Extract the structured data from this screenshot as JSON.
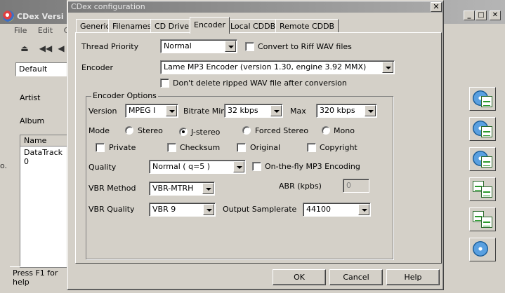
{
  "main_window": {
    "title": "CDex Versi",
    "menu": [
      "File",
      "Edit",
      "Con"
    ],
    "profile": "Default",
    "artist_label": "Artist",
    "album_label": "Album",
    "track_header": "Name",
    "track_row": "DataTrack 0",
    "status": "Press F1 for help",
    "left_edge_text": "o."
  },
  "dialog": {
    "title": "CDex configuration",
    "close_glyph": "✕",
    "tabs": [
      {
        "label": "Generic",
        "active": false
      },
      {
        "label": "Filenames",
        "active": false
      },
      {
        "label": "CD Drive",
        "active": false
      },
      {
        "label": "Encoder",
        "active": true
      },
      {
        "label": "Local CDDB",
        "active": false
      },
      {
        "label": "Remote CDDB",
        "active": false
      }
    ],
    "encoder_tab": {
      "thread_priority_label": "Thread Priority",
      "thread_priority_value": "Normal",
      "convert_riff_label": "Convert to Riff WAV files",
      "encoder_label": "Encoder",
      "encoder_value": "Lame MP3 Encoder (version 1.30, engine 3.92 MMX)",
      "dont_delete_label": "Don't delete ripped WAV file after conversion",
      "group_title": "Encoder Options",
      "version_label": "Version",
      "version_value": "MPEG I",
      "bitrate_min_label": "Bitrate Min",
      "bitrate_min_value": "32 kbps",
      "max_label": "Max",
      "max_value": "320 kbps",
      "mode_label": "Mode",
      "mode_options": [
        "Stereo",
        "J-stereo",
        "Forced Stereo",
        "Mono"
      ],
      "mode_selected": "J-stereo",
      "private_label": "Private",
      "checksum_label": "Checksum",
      "original_label": "Original",
      "copyright_label": "Copyright",
      "quality_label": "Quality",
      "quality_value": "Normal ( q=5 )",
      "onthefly_label": "On-the-fly MP3 Encoding",
      "vbr_method_label": "VBR Method",
      "vbr_method_value": "VBR-MTRH",
      "abr_label": "ABR (kpbs)",
      "abr_value": "0",
      "vbr_quality_label": "VBR Quality",
      "vbr_quality_value": "VBR 9",
      "output_samplerate_label": "Output Samplerate",
      "output_samplerate_value": "44100"
    },
    "buttons": {
      "ok": "OK",
      "cancel": "Cancel",
      "help": "Help"
    }
  },
  "icons": [
    "eject-icon",
    "rewind-icon",
    "skip-back-icon",
    "rip-to-wav-icon",
    "rip-to-mp3-icon",
    "rip-partial-icon",
    "convert-wav-icon",
    "convert-mp3-icon",
    "cddb-search-icon"
  ]
}
